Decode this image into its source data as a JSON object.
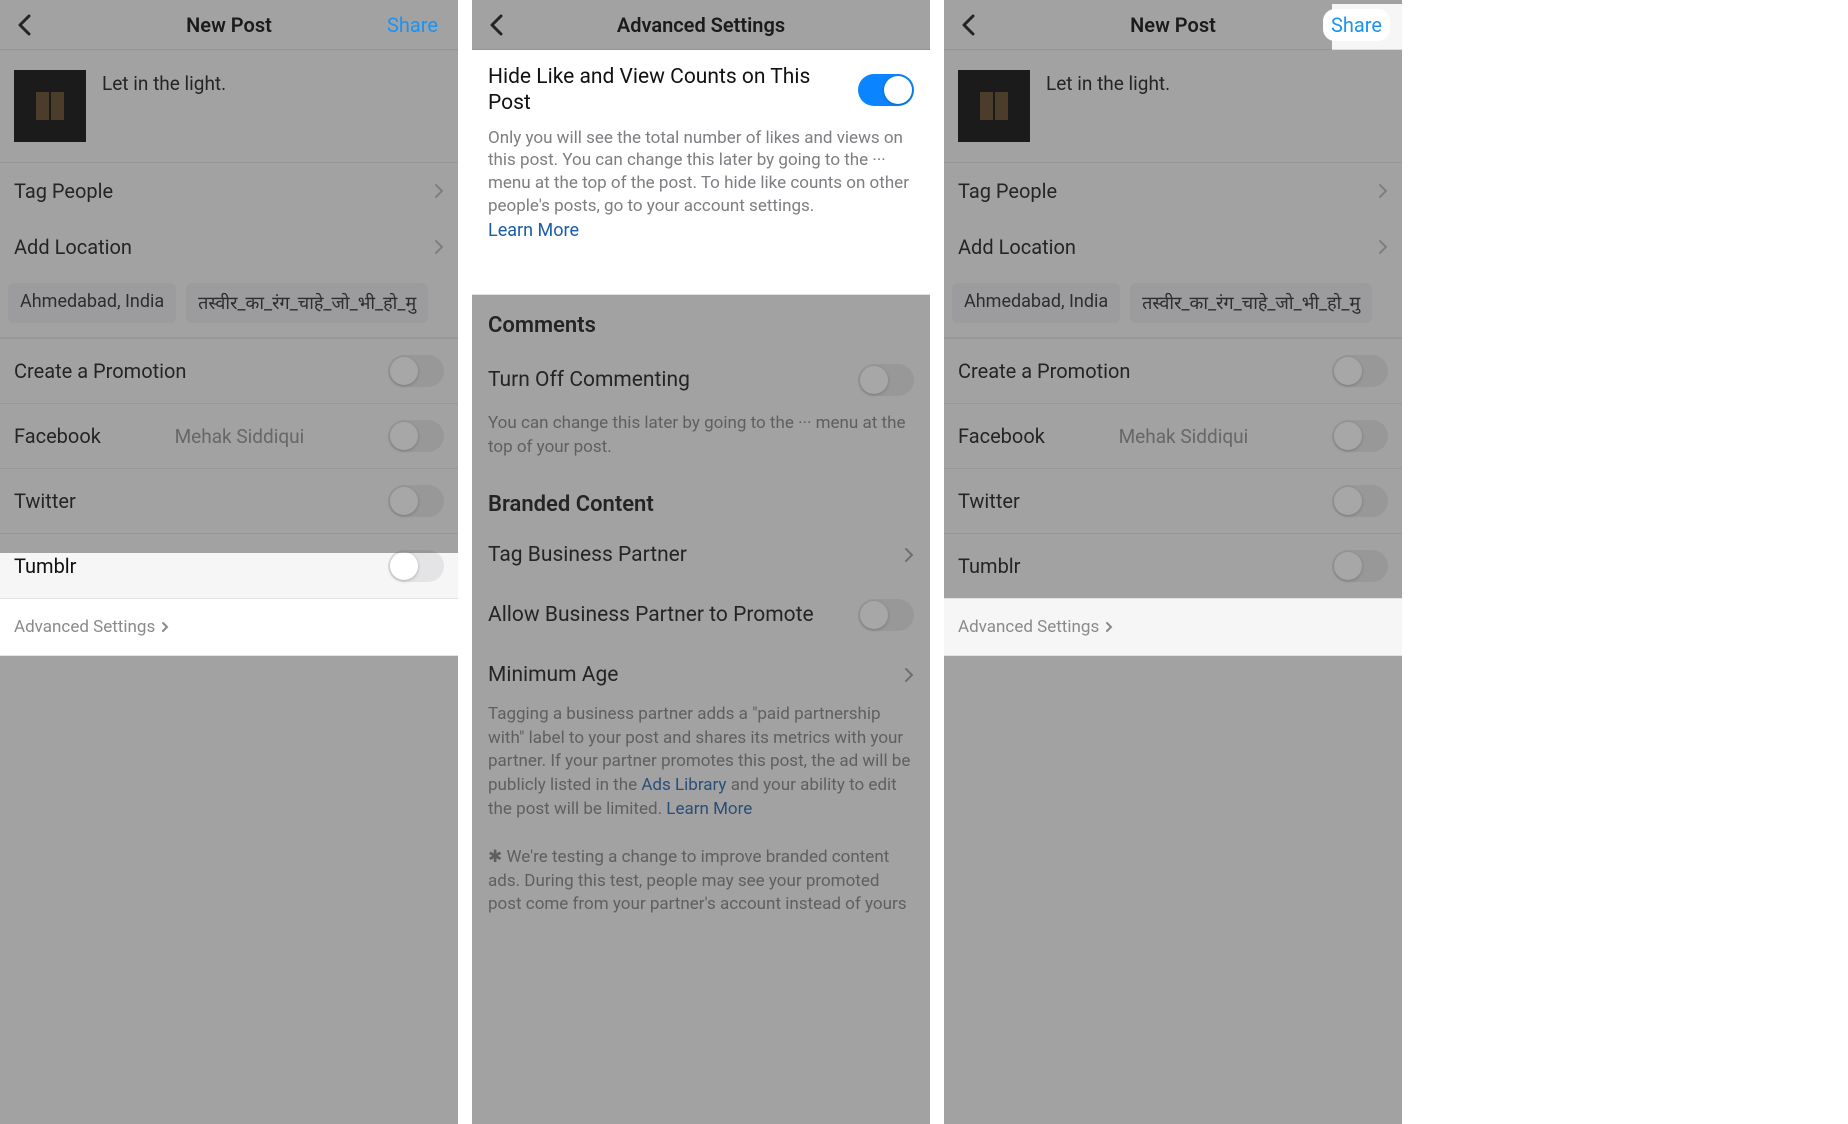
{
  "panel1": {
    "title": "New Post",
    "share_label": "Share",
    "caption": "Let in the light.",
    "tag_people": "Tag People",
    "add_location": "Add Location",
    "chip_a": "Ahmedabad, India",
    "chip_b": "तस्वीर_का_रंग_चाहे_जो_भी_हो_मु",
    "create_promotion": "Create a Promotion",
    "facebook": "Facebook",
    "facebook_account": "Mehak Siddiqui",
    "twitter": "Twitter",
    "tumblr": "Tumblr",
    "advanced_settings": "Advanced Settings"
  },
  "panel2": {
    "title": "Advanced Settings",
    "hide_title": "Hide Like and View Counts on This Post",
    "hide_desc": "Only you will see the total number of likes and views on this post. You can change this later by going to the ··· menu at the top of the post. To hide like counts on other people's posts, go to your account settings.",
    "learn_more": "Learn More",
    "comments_head": "Comments",
    "turn_off_commenting": "Turn Off Commenting",
    "turn_off_desc": "You can change this later by going to the ··· menu at the top of your post.",
    "branded_head": "Branded Content",
    "tag_business": "Tag Business Partner",
    "allow_promote": "Allow Business Partner to Promote",
    "min_age": "Minimum Age",
    "branded_desc_a": "Tagging a business partner adds a \"paid partnership with\" label to your post and shares its metrics with your partner. If your partner promotes this post, the ad will be publicly listed in the ",
    "ads_library": "Ads Library",
    "branded_desc_b": " and your ability to edit the post will be limited. ",
    "branded_footnote": "✱ We're testing a change to improve branded content ads. During this test, people may see your promoted post come from your partner's account instead of yours"
  },
  "panel3": {
    "title": "New Post",
    "share_label": "Share",
    "caption": "Let in the light.",
    "tag_people": "Tag People",
    "add_location": "Add Location",
    "chip_a": "Ahmedabad, India",
    "chip_b": "तस्वीर_का_रंग_चाहे_जो_भी_हो_मु",
    "create_promotion": "Create a Promotion",
    "facebook": "Facebook",
    "facebook_account": "Mehak Siddiqui",
    "twitter": "Twitter",
    "tumblr": "Tumblr",
    "advanced_settings": "Advanced Settings"
  }
}
